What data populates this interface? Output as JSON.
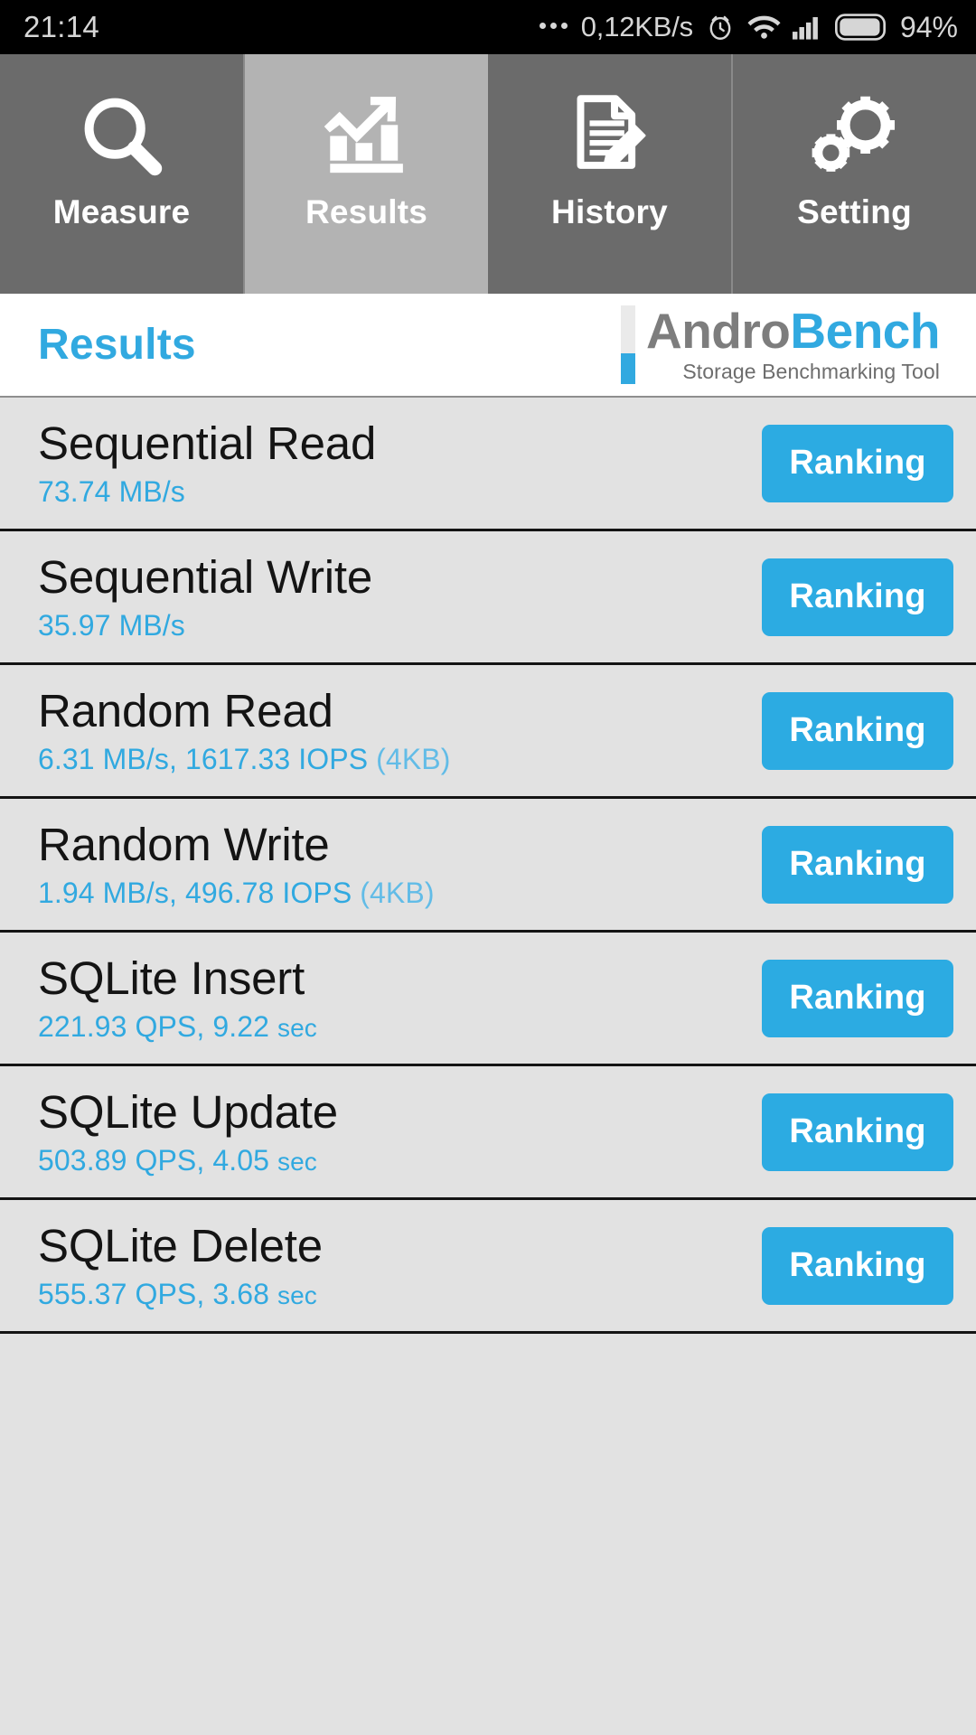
{
  "statusbar": {
    "clock": "21:14",
    "network_speed": "0,12KB/s",
    "battery_percent": "94%",
    "icons": [
      "more-dots-icon",
      "alarm-clock-icon",
      "wifi-icon",
      "cellular-signal-icon",
      "battery-icon"
    ]
  },
  "tabs": [
    {
      "label": "Measure",
      "icon": "magnifier-icon",
      "active": false
    },
    {
      "label": "Results",
      "icon": "bar-chart-arrow-icon",
      "active": true
    },
    {
      "label": "History",
      "icon": "document-pencil-icon",
      "active": false
    },
    {
      "label": "Setting",
      "icon": "gears-icon",
      "active": false
    }
  ],
  "header": {
    "title": "Results",
    "logo": {
      "part1": "Andro",
      "part2": "Bench",
      "tagline": "Storage Benchmarking Tool",
      "accent_color": "#31a9e0",
      "gray_color": "#7d7d7d"
    }
  },
  "results": {
    "button_label": "Ranking",
    "accent_color": "#2cabe2",
    "rows": [
      {
        "name": "Sequential Read",
        "value": "73.74 MB/s",
        "value_main": "73.74 MB/s",
        "value_suffix": ""
      },
      {
        "name": "Sequential Write",
        "value": "35.97 MB/s",
        "value_main": "35.97 MB/s",
        "value_suffix": ""
      },
      {
        "name": "Random Read",
        "value": "6.31 MB/s, 1617.33 IOPS (4KB)",
        "value_main": "6.31 MB/s, 1617.33 IOPS ",
        "value_suffix": "(4KB)"
      },
      {
        "name": "Random Write",
        "value": "1.94 MB/s, 496.78 IOPS (4KB)",
        "value_main": "1.94 MB/s, 496.78 IOPS ",
        "value_suffix": "(4KB)"
      },
      {
        "name": "SQLite Insert",
        "value": "221.93 QPS, 9.22 sec",
        "value_main": "221.93 QPS, 9.22 ",
        "value_suffix": "sec"
      },
      {
        "name": "SQLite Update",
        "value": "503.89 QPS, 4.05 sec",
        "value_main": "503.89 QPS, 4.05 ",
        "value_suffix": "sec"
      },
      {
        "name": "SQLite Delete",
        "value": "555.37 QPS, 3.68 sec",
        "value_main": "555.37 QPS, 3.68 ",
        "value_suffix": "sec"
      }
    ]
  }
}
